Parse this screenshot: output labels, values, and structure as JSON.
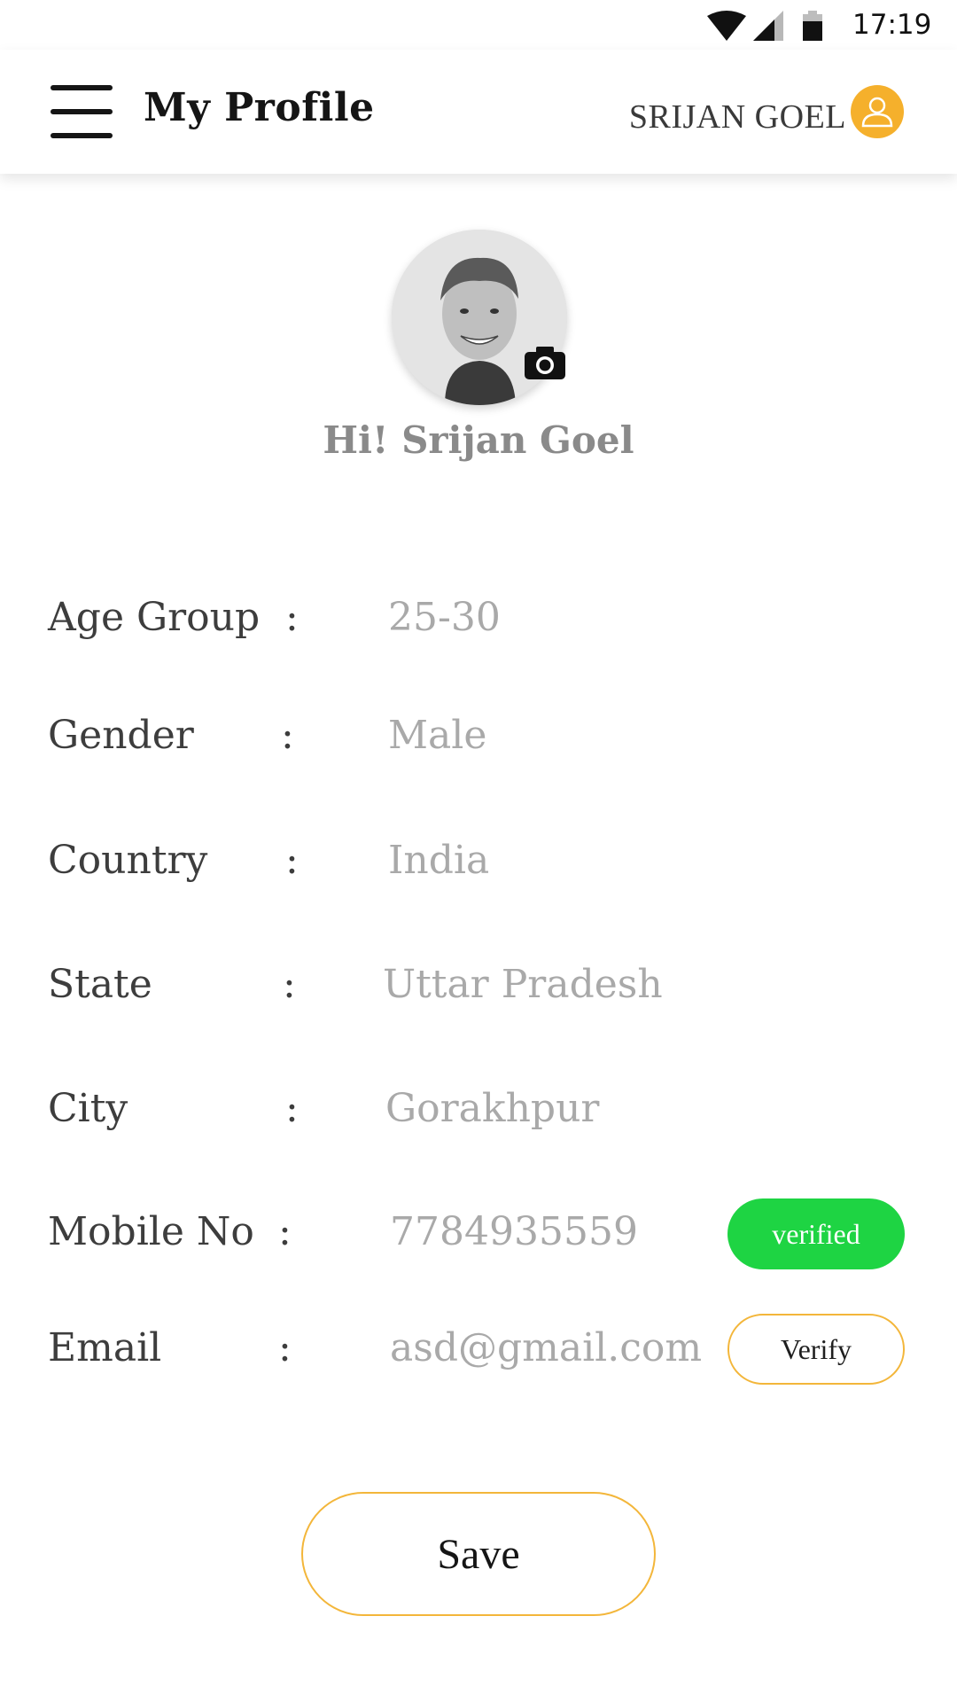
{
  "status_bar": {
    "time": "17:19",
    "icons": [
      "wifi-icon",
      "cellular-signal-icon",
      "battery-icon"
    ]
  },
  "header": {
    "title": "My Profile",
    "user_name": "SRIJAN GOEL",
    "menu_icon": "hamburger-menu-icon",
    "avatar_icon": "user-icon"
  },
  "profile": {
    "greeting": "Hi! Srijan Goel",
    "photo_icon": "camera-icon"
  },
  "fields": {
    "age_group": {
      "label": "Age Group",
      "separator": ":",
      "value": "25-30"
    },
    "gender": {
      "label": "Gender",
      "separator": ":",
      "value": "Male"
    },
    "country": {
      "label": "Country",
      "separator": ":",
      "value": "India"
    },
    "state": {
      "label": "State",
      "separator": ":",
      "value": "Uttar Pradesh"
    },
    "city": {
      "label": "City",
      "separator": ":",
      "value": "Gorakhpur"
    },
    "mobile": {
      "label": "Mobile No",
      "separator": ":",
      "value": "7784935559",
      "status": "verified"
    },
    "email": {
      "label": "Email",
      "separator": ":",
      "value": "asd@gmail.com",
      "action": "Verify"
    }
  },
  "actions": {
    "save_label": "Save"
  },
  "colors": {
    "accent": "#f5b02c",
    "verified_green": "#1ed443",
    "value_gray": "#a9a9a9",
    "label_dark": "#3d3d3d"
  }
}
